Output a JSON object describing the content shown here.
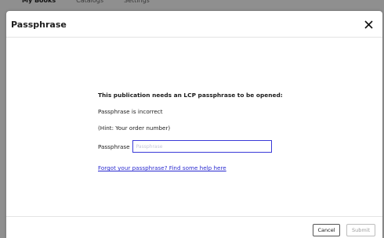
{
  "background_tabs": [
    "My Books",
    "Catalogs",
    "Settings"
  ],
  "dialog": {
    "title": "Passphrase",
    "heading": "This publication needs an LCP passphrase to be opened:",
    "error": "Passphrase is incorrect",
    "hint": "(Hint: Your order number)",
    "passphrase_label": "Passphrase",
    "passphrase_placeholder": "Passphrase",
    "passphrase_value": "",
    "help_link": "Forgot your passphrase? Find some help here",
    "cancel_label": "Cancel",
    "submit_label": "Submit"
  },
  "colors": {
    "accent": "#3a3ad8",
    "link": "#2a2ad0",
    "overlay": "#8f8f8f"
  },
  "icons": {
    "close": "close-icon"
  }
}
